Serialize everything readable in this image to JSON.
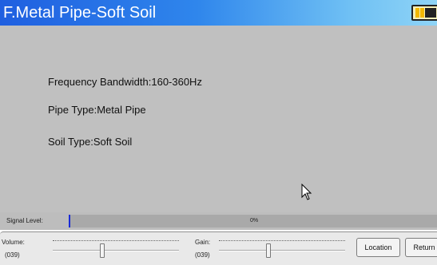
{
  "window": {
    "title": "F.Metal Pipe-Soft Soil",
    "battery_icon": "battery-icon"
  },
  "info": {
    "frequency": "Frequency Bandwidth:160-360Hz",
    "pipe_type": "Pipe Type:Metal Pipe",
    "soil_type": "Soil Type:Soft Soil"
  },
  "signal": {
    "label": "Signal Level:",
    "percent_text": "0%",
    "percent_value": 0
  },
  "controls": {
    "volume_label": "Volume:",
    "volume_value": "(039)",
    "volume_level": 0.39,
    "gain_label": "Gain:",
    "gain_value": "(039)",
    "gain_level": 0.39,
    "location_button": "Location",
    "return_button": "Return"
  },
  "colors": {
    "title_bar_start": "#1f5fe0",
    "title_bar_end": "#8fd4f6",
    "main_background": "#c0c0c0",
    "signal_fill": "#1a2bd6"
  }
}
